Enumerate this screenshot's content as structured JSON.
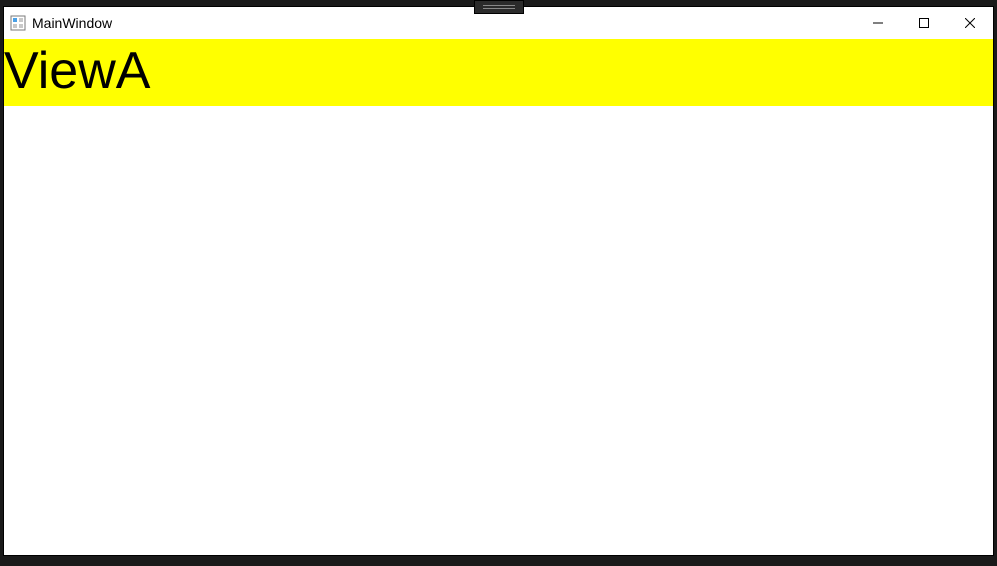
{
  "window": {
    "title": "MainWindow"
  },
  "view": {
    "header_label": "ViewA"
  },
  "colors": {
    "view_header_bg": "#ffff00",
    "window_bg": "#ffffff"
  }
}
